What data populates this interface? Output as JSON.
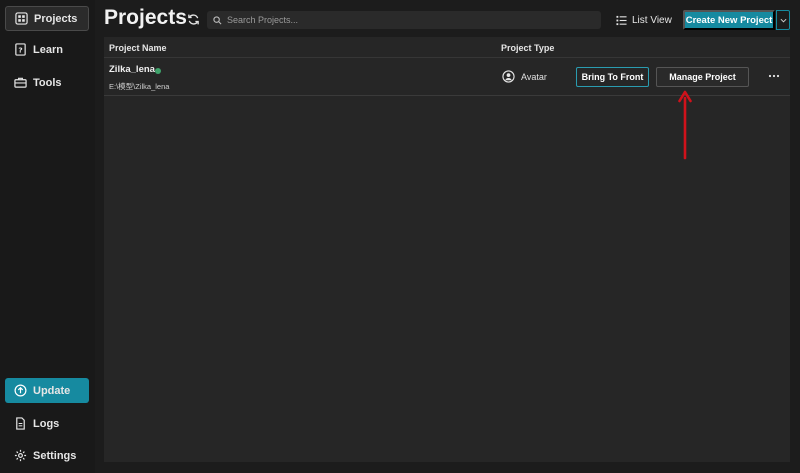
{
  "sidebar": {
    "items": [
      {
        "label": "Projects",
        "icon": "grid-icon",
        "active": true
      },
      {
        "label": "Learn",
        "icon": "help-book-icon"
      },
      {
        "label": "Tools",
        "icon": "toolbox-icon"
      }
    ],
    "bottom": [
      {
        "label": "Update",
        "icon": "upload-circle-icon"
      },
      {
        "label": "Logs",
        "icon": "document-icon"
      },
      {
        "label": "Settings",
        "icon": "gear-icon"
      }
    ]
  },
  "header": {
    "title": "Projects",
    "search_placeholder": "Search Projects...",
    "list_view_label": "List View",
    "create_label": "Create New Project"
  },
  "table": {
    "columns": [
      "Project Name",
      "Project Type"
    ],
    "rows": [
      {
        "name": "Zilka_lena",
        "path": "E:\\模型\\Zilka_lena",
        "type": "Avatar",
        "status": "online",
        "bring_to_front": "Bring To Front",
        "manage": "Manage Project"
      }
    ]
  },
  "colors": {
    "accent": "#168aa0",
    "status_online": "#3fa36b",
    "annotation_arrow": "#d0121b"
  }
}
